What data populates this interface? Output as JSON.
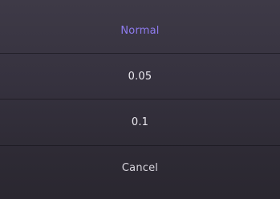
{
  "picker": {
    "options": [
      {
        "label": "Normal",
        "selected": true
      },
      {
        "label": "0.05",
        "selected": false
      },
      {
        "label": "0.1",
        "selected": false
      }
    ],
    "cancel_label": "Cancel",
    "accent_color": "#8f7cf0"
  }
}
